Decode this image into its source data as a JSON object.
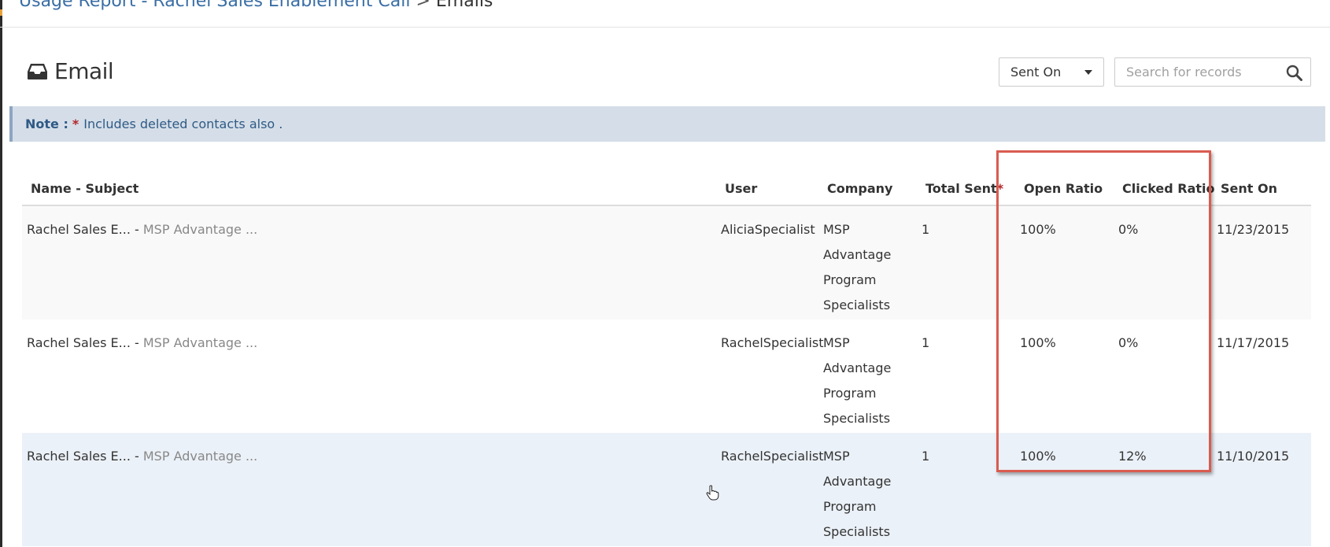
{
  "breadcrumb": {
    "report_link": "Usage Report - Rachel Sales Enablement Call",
    "separator": ">",
    "current": "Emails"
  },
  "page": {
    "title": "Email",
    "title_icon": "inbox-icon"
  },
  "toolbar": {
    "sort_selected": "Sent On",
    "search_placeholder": "Search for records",
    "search_icon": "search-icon"
  },
  "note": {
    "label": "Note :",
    "star": "*",
    "text": "Includes deleted contacts also ."
  },
  "table": {
    "columns": {
      "name_subject": "Name - Subject",
      "user": "User",
      "company": "Company",
      "total_sent": "Total Sent",
      "total_sent_star": "*",
      "open_ratio": "Open Ratio",
      "clicked_ratio": "Clicked Ratio",
      "sent_on": "Sent On"
    },
    "rows": [
      {
        "name": "Rachel Sales E...",
        "separator": " - ",
        "subject": "MSP Advantage ...",
        "user": "AliciaSpecialist",
        "company": "MSP Advantage Program Specialists",
        "total_sent": "1",
        "open_ratio": "100%",
        "clicked_ratio": "0%",
        "sent_on": "11/23/2015"
      },
      {
        "name": "Rachel Sales E...",
        "separator": " - ",
        "subject": "MSP Advantage ...",
        "user": "RachelSpecialist",
        "company": "MSP Advantage Program Specialists",
        "total_sent": "1",
        "open_ratio": "100%",
        "clicked_ratio": "0%",
        "sent_on": "11/17/2015"
      },
      {
        "name": "Rachel Sales E...",
        "separator": " - ",
        "subject": "MSP Advantage ...",
        "user": "RachelSpecialist",
        "company": "MSP Advantage Program Specialists",
        "total_sent": "1",
        "open_ratio": "100%",
        "clicked_ratio": "12%",
        "sent_on": "11/10/2015"
      }
    ]
  },
  "colors": {
    "link": "#3a6ea5",
    "note_background": "#d5dee8",
    "required_star": "#b3262a",
    "highlight_border": "#d95c50"
  }
}
